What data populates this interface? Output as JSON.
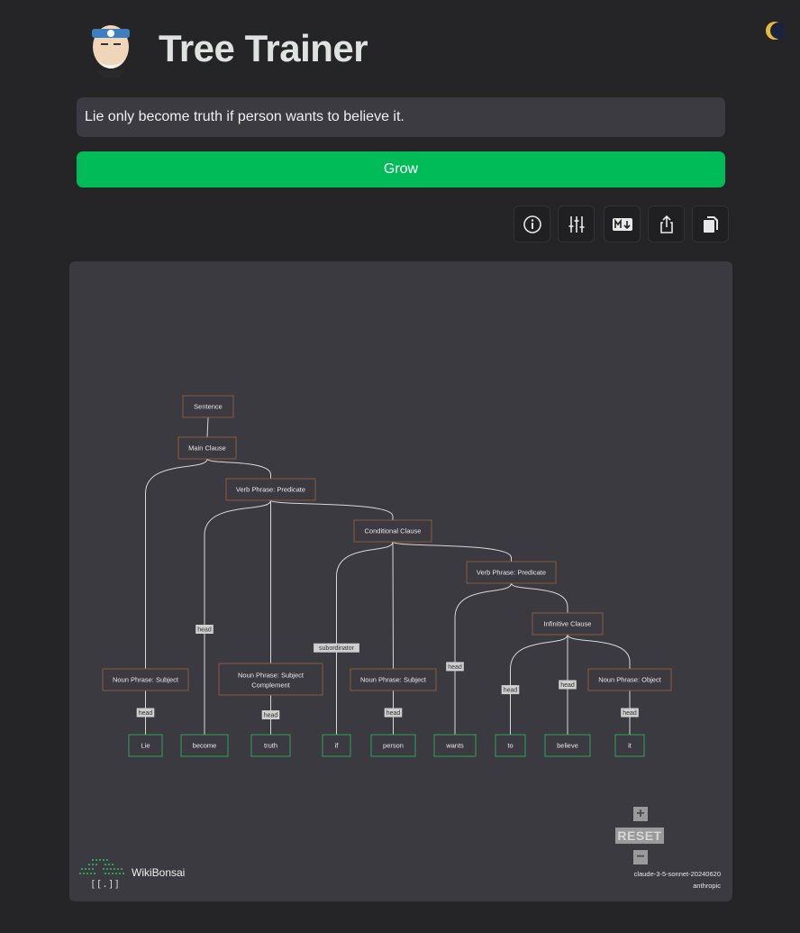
{
  "app": {
    "title": "Tree Trainer"
  },
  "input": {
    "value": "Lie only become truth if person wants to believe it."
  },
  "actions": {
    "grow_label": "Grow"
  },
  "toolbar": [
    {
      "icon": "info-icon"
    },
    {
      "icon": "sliders-icon"
    },
    {
      "icon": "markdown-icon"
    },
    {
      "icon": "share-icon"
    },
    {
      "icon": "copy-icon"
    }
  ],
  "tree": {
    "nodes": [
      {
        "id": "sentence",
        "label": "Sentence",
        "kind": "phrase"
      },
      {
        "id": "main",
        "label": "Main Clause",
        "kind": "phrase"
      },
      {
        "id": "vp1",
        "label": "Verb Phrase: Predicate",
        "kind": "phrase"
      },
      {
        "id": "cond",
        "label": "Conditional Clause",
        "kind": "phrase"
      },
      {
        "id": "vp2",
        "label": "Verb Phrase: Predicate",
        "kind": "phrase"
      },
      {
        "id": "inf",
        "label": "Infinitive Clause",
        "kind": "phrase"
      },
      {
        "id": "np1",
        "label": "Noun Phrase: Subject",
        "kind": "phrase"
      },
      {
        "id": "np2",
        "label": "Noun Phrase: Subject Complement",
        "kind": "phrase"
      },
      {
        "id": "np3",
        "label": "Noun Phrase: Subject",
        "kind": "phrase"
      },
      {
        "id": "np4",
        "label": "Noun Phrase: Object",
        "kind": "phrase"
      },
      {
        "id": "w_lie",
        "label": "Lie",
        "kind": "word"
      },
      {
        "id": "w_become",
        "label": "become",
        "kind": "word"
      },
      {
        "id": "w_truth",
        "label": "truth",
        "kind": "word"
      },
      {
        "id": "w_if",
        "label": "if",
        "kind": "word"
      },
      {
        "id": "w_person",
        "label": "person",
        "kind": "word"
      },
      {
        "id": "w_wants",
        "label": "wants",
        "kind": "word"
      },
      {
        "id": "w_to",
        "label": "to",
        "kind": "word"
      },
      {
        "id": "w_believe",
        "label": "believe",
        "kind": "word"
      },
      {
        "id": "w_it",
        "label": "it",
        "kind": "word"
      }
    ],
    "edges": [
      {
        "from": "sentence",
        "to": "main"
      },
      {
        "from": "main",
        "to": "np1"
      },
      {
        "from": "main",
        "to": "vp1"
      },
      {
        "from": "vp1",
        "to": "w_become",
        "label": "head"
      },
      {
        "from": "vp1",
        "to": "np2"
      },
      {
        "from": "vp1",
        "to": "cond"
      },
      {
        "from": "cond",
        "to": "w_if",
        "label": "subordinator"
      },
      {
        "from": "cond",
        "to": "np3"
      },
      {
        "from": "cond",
        "to": "vp2"
      },
      {
        "from": "vp2",
        "to": "w_wants",
        "label": "head"
      },
      {
        "from": "vp2",
        "to": "inf"
      },
      {
        "from": "inf",
        "to": "w_to",
        "label": "head"
      },
      {
        "from": "inf",
        "to": "w_believe",
        "label": "head"
      },
      {
        "from": "inf",
        "to": "np4"
      },
      {
        "from": "np1",
        "to": "w_lie",
        "label": "head"
      },
      {
        "from": "np2",
        "to": "w_truth",
        "label": "head"
      },
      {
        "from": "np3",
        "to": "w_person",
        "label": "head"
      },
      {
        "from": "np4",
        "to": "w_it",
        "label": "head"
      }
    ]
  },
  "zoom": {
    "plus": "+",
    "reset": "RESET",
    "minus": "−"
  },
  "footer": {
    "brand": "WikiBonsai",
    "tag": "[[.]]",
    "model": "claude-3-5-sonnet-20240620",
    "vendor": "anthropic"
  },
  "colors": {
    "grow": "#00bc58",
    "phrase_border": "#8a5a3c",
    "word_border": "#2fa35a",
    "background": "#252527",
    "panel": "#3b3a40"
  }
}
